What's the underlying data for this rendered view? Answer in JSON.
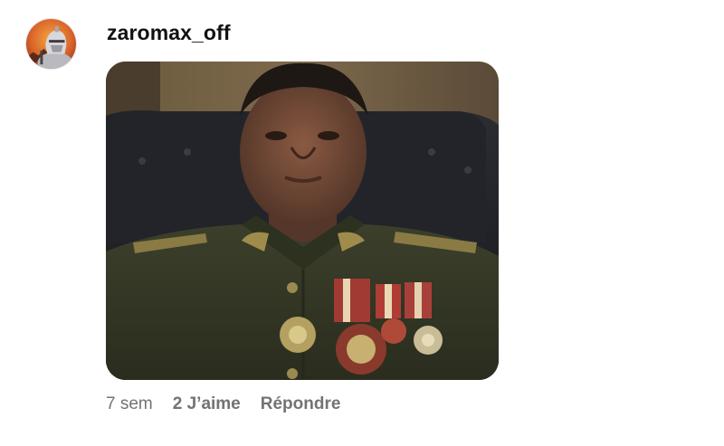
{
  "comment": {
    "username": "zaromax_off",
    "avatar_icon": "knight-avatar-icon",
    "media_description_icon": "gif-image",
    "time": "7 sem",
    "likes": "2 J’aime",
    "reply": "Répondre"
  },
  "colors": {
    "text_primary": "#111111",
    "text_secondary": "#737373",
    "background": "#ffffff"
  }
}
